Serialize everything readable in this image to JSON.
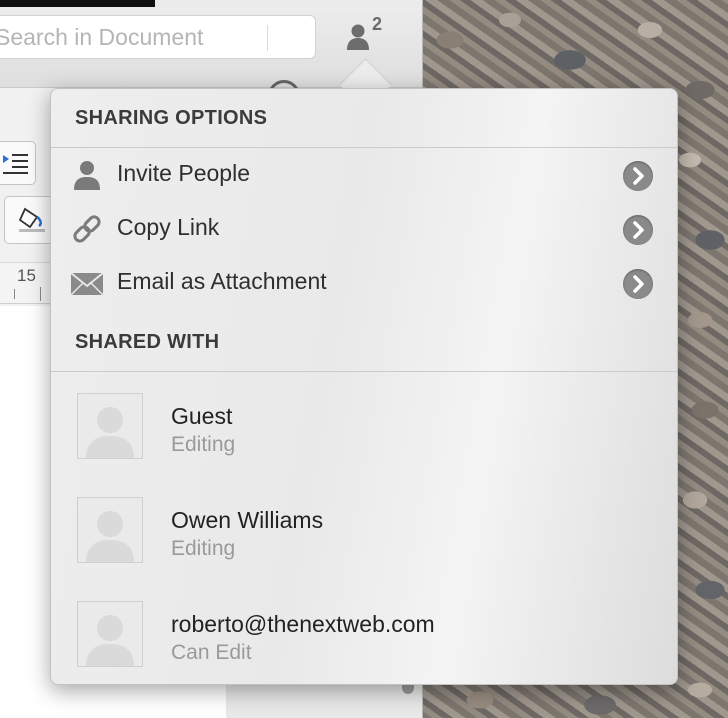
{
  "search": {
    "placeholder": "Search in Document"
  },
  "share_button": {
    "count": "2",
    "icon": "person-icon"
  },
  "ruler": {
    "label": "15"
  },
  "popover": {
    "sharing_options_title": "SHARING OPTIONS",
    "options": [
      {
        "label": "Invite People",
        "icon": "person-icon"
      },
      {
        "label": "Copy Link",
        "icon": "link-icon"
      },
      {
        "label": "Email as Attachment",
        "icon": "envelope-icon"
      }
    ],
    "shared_with_title": "SHARED WITH",
    "users": [
      {
        "name": "Guest",
        "permission": "Editing"
      },
      {
        "name": "Owen Williams",
        "permission": "Editing"
      },
      {
        "name": "roberto@thenextweb.com",
        "permission": "Can Edit"
      }
    ]
  }
}
